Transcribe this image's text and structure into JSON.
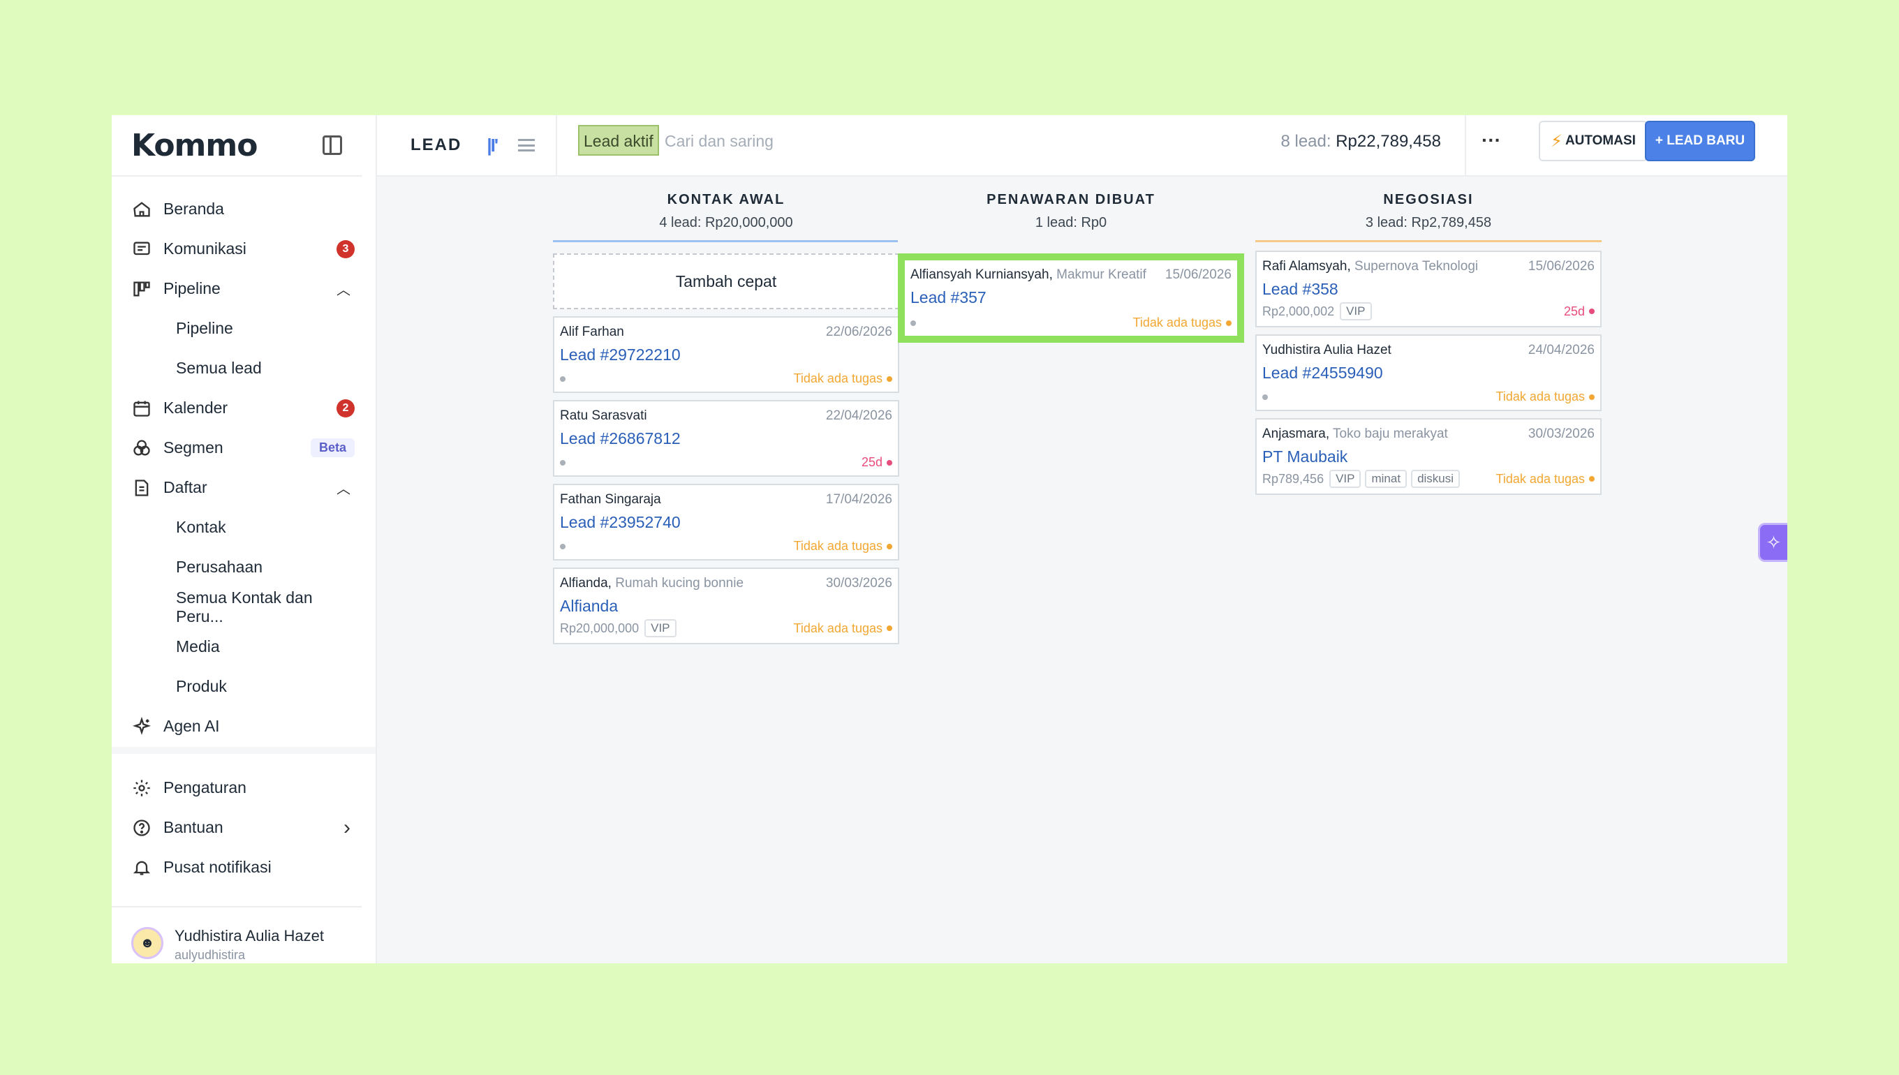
{
  "app": {
    "logo": "Kommo"
  },
  "sidebar": {
    "items": [
      {
        "label": "Beranda",
        "icon": "home-icon"
      },
      {
        "label": "Komunikasi",
        "icon": "chat-icon",
        "badge": "3"
      },
      {
        "label": "Pipeline",
        "icon": "pipeline-icon",
        "expanded": true
      },
      {
        "label": "Pipeline",
        "sub": true
      },
      {
        "label": "Semua lead",
        "sub": true
      },
      {
        "label": "Kalender",
        "icon": "calendar-icon",
        "badge": "2"
      },
      {
        "label": "Segmen",
        "icon": "segment-icon",
        "tag": "Beta"
      },
      {
        "label": "Daftar",
        "icon": "list-doc-icon",
        "expanded": true
      },
      {
        "label": "Kontak",
        "sub": true
      },
      {
        "label": "Perusahaan",
        "sub": true
      },
      {
        "label": "Semua Kontak dan Peru...",
        "sub": true
      },
      {
        "label": "Media",
        "sub": true
      },
      {
        "label": "Produk",
        "sub": true
      },
      {
        "label": "Agen AI",
        "icon": "sparkle-icon"
      }
    ],
    "bottom": [
      {
        "label": "Pengaturan",
        "icon": "gear-icon"
      },
      {
        "label": "Bantuan",
        "icon": "help-icon"
      },
      {
        "label": "Pusat notifikasi",
        "icon": "bell-icon"
      }
    ],
    "user": {
      "name": "Yudhistira Aulia Hazet",
      "login": "aulyudhistira"
    }
  },
  "topbar": {
    "title": "LEAD",
    "filter_tag": "Lead aktif",
    "search_placeholder": "Cari dan saring",
    "summary_prefix": "8 lead:",
    "summary_value": "Rp22,789,458",
    "more": "···",
    "automation_label": "AUTOMASI",
    "new_lead_label": "+ LEAD BARU"
  },
  "colors": {
    "accent": "#4c82e8",
    "highlight": "#8fe05c",
    "status_orange": "#f2a732",
    "status_pink": "#e84c7c"
  },
  "columns": [
    {
      "name": "KONTAK AWAL",
      "summary": "4 lead: Rp20,000,000",
      "line_color": "#9cc0f0",
      "quick_add": "Tambah cepat",
      "cards": [
        {
          "contact": "Alif Farhan",
          "company": "",
          "date": "22/06/2026",
          "lead": "Lead #29722210",
          "price": "",
          "tags": [],
          "status": "Tidak ada tugas",
          "status_type": "orange"
        },
        {
          "contact": "Ratu Sarasvati",
          "company": "",
          "date": "22/04/2026",
          "lead": "Lead #26867812",
          "price": "",
          "tags": [],
          "status": "25d",
          "status_type": "pink"
        },
        {
          "contact": "Fathan Singaraja",
          "company": "",
          "date": "17/04/2026",
          "lead": "Lead #23952740",
          "price": "",
          "tags": [],
          "status": "Tidak ada tugas",
          "status_type": "orange"
        },
        {
          "contact": "Alfianda,",
          "company": "Rumah kucing bonnie",
          "date": "30/03/2026",
          "lead": "Alfianda",
          "price": "Rp20,000,000",
          "tags": [
            "VIP"
          ],
          "status": "Tidak ada tugas",
          "status_type": "orange"
        }
      ]
    },
    {
      "name": "PENAWARAN DIBUAT",
      "summary": "1 lead: Rp0",
      "line_color": "#f5f6f7",
      "cards": [
        {
          "contact": "Alfiansyah Kurniansyah,",
          "company": "Makmur Kreatif",
          "date": "15/06/2026",
          "lead": "Lead #357",
          "price": "",
          "tags": [],
          "status": "Tidak ada tugas",
          "status_type": "orange",
          "highlight": true
        }
      ]
    },
    {
      "name": "NEGOSIASI",
      "summary": "3 lead: Rp2,789,458",
      "line_color": "#f6c98a",
      "cards": [
        {
          "contact": "Rafi Alamsyah,",
          "company": "Supernova Teknologi",
          "date": "15/06/2026",
          "lead": "Lead #358",
          "price": "Rp2,000,002",
          "tags": [
            "VIP"
          ],
          "status": "25d",
          "status_type": "pink"
        },
        {
          "contact": "Yudhistira Aulia Hazet",
          "company": "",
          "date": "24/04/2026",
          "lead": "Lead #24559490",
          "price": "",
          "tags": [],
          "status": "Tidak ada tugas",
          "status_type": "orange"
        },
        {
          "contact": "Anjasmara,",
          "company": "Toko baju merakyat",
          "date": "30/03/2026",
          "lead": "PT Maubaik",
          "price": "Rp789,456",
          "tags": [
            "VIP",
            "minat",
            "diskusi"
          ],
          "status": "Tidak ada tugas",
          "status_type": "orange"
        }
      ]
    }
  ]
}
